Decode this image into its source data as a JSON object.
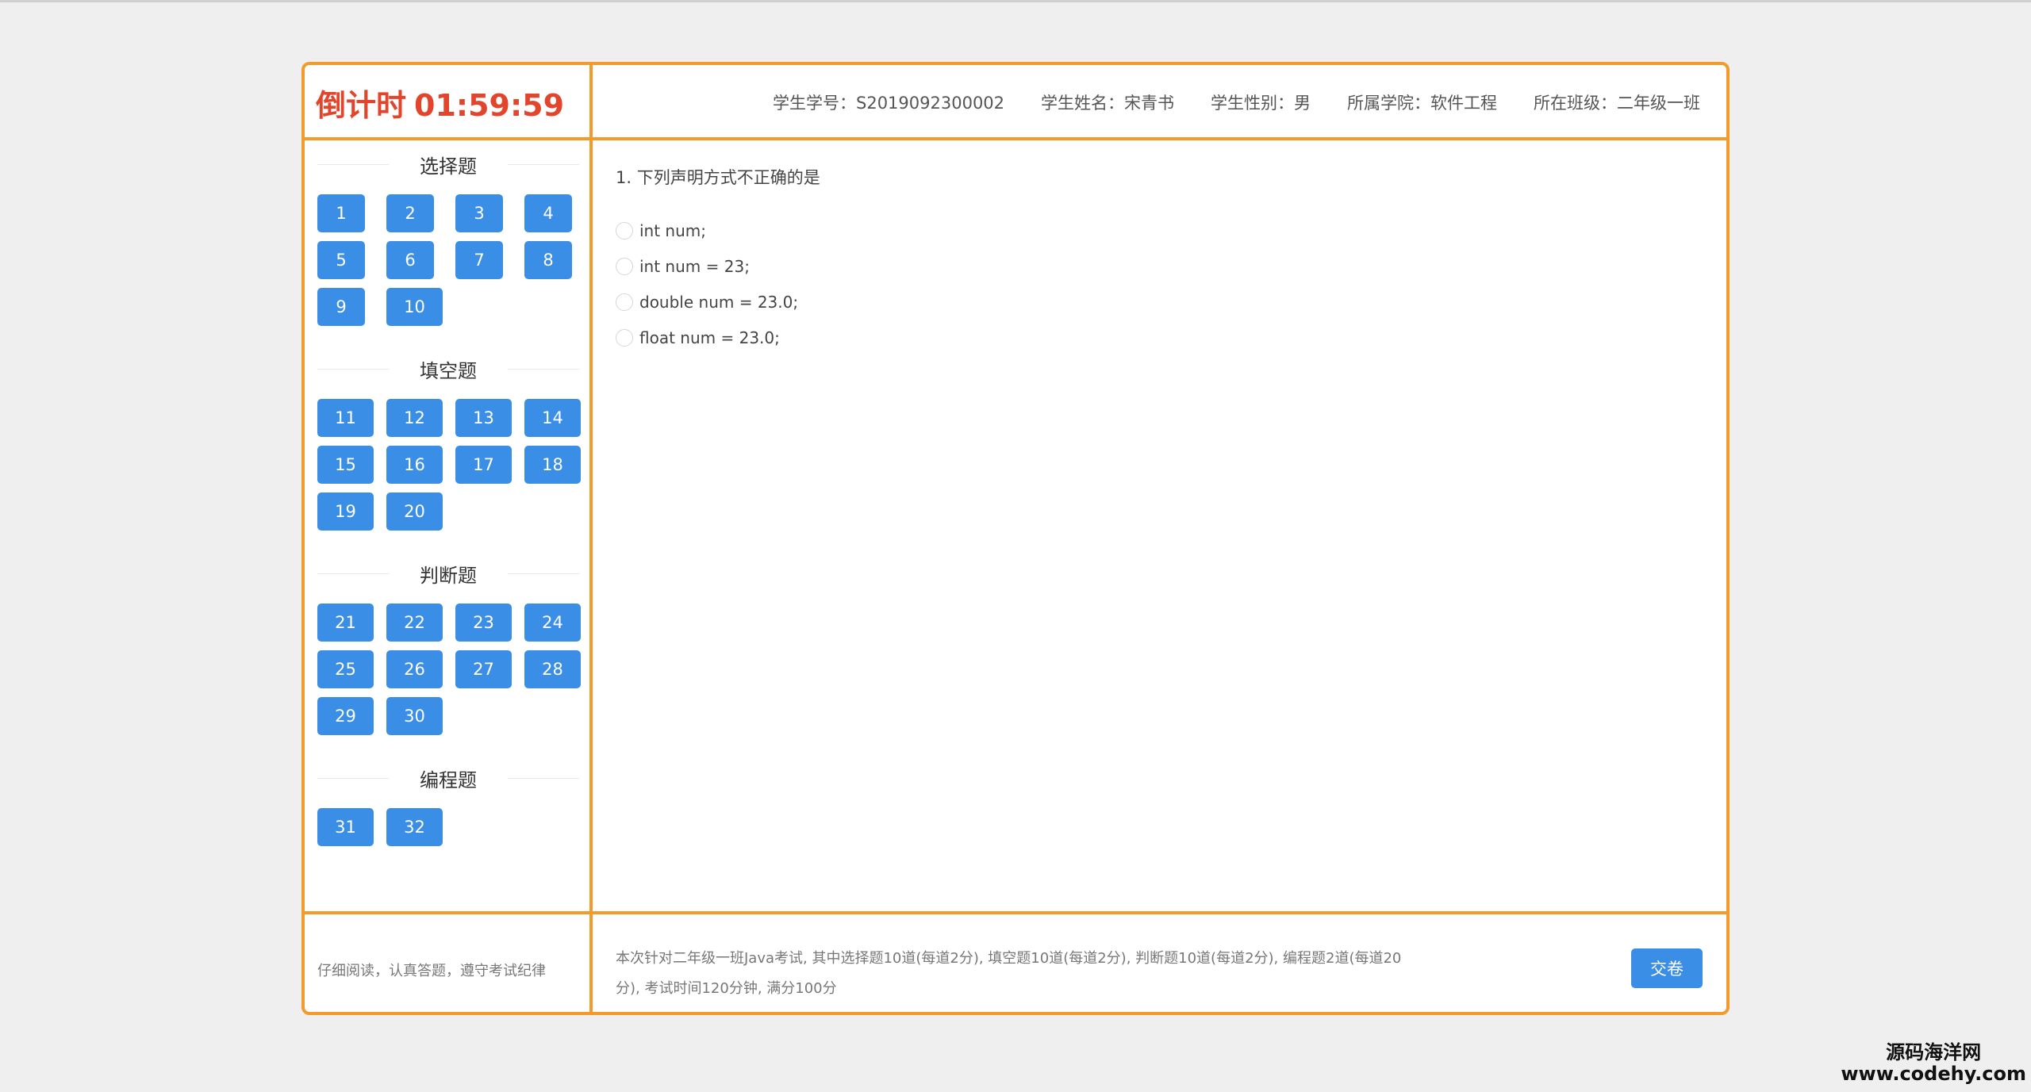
{
  "header": {
    "countdown_label": "倒计时",
    "countdown_time": "01:59:59",
    "student_id": "学生学号：S2019092300002",
    "student_name": "学生姓名：宋青书",
    "student_gender": "学生性别：男",
    "college": "所属学院：软件工程",
    "class": "所在班级：二年级一班"
  },
  "sections": [
    {
      "title": "选择题",
      "questions": [
        "1",
        "2",
        "3",
        "4",
        "5",
        "6",
        "7",
        "8",
        "9",
        "10"
      ]
    },
    {
      "title": "填空题",
      "questions": [
        "11",
        "12",
        "13",
        "14",
        "15",
        "16",
        "17",
        "18",
        "19",
        "20"
      ]
    },
    {
      "title": "判断题",
      "questions": [
        "21",
        "22",
        "23",
        "24",
        "25",
        "26",
        "27",
        "28",
        "29",
        "30"
      ]
    },
    {
      "title": "编程题",
      "questions": [
        "31",
        "32"
      ]
    }
  ],
  "question": {
    "text": "1. 下列声明方式不正确的是",
    "options": [
      "int num;",
      "int num = 23;",
      "double num = 23.0;",
      "float num = 23.0;"
    ]
  },
  "footer": {
    "note": "仔细阅读，认真答题，遵守考试纪律",
    "description": "本次针对二年级一班Java考试, 其中选择题10道(每道2分), 填空题10道(每道2分), 判断题10道(每道2分), 编程题2道(每道20分), 考试时间120分钟, 满分100分",
    "submit_label": "交卷"
  },
  "watermark": {
    "line1": "源码海洋网",
    "line2": "www.codehy.com"
  },
  "colors": {
    "accent_border": "#f29b2c",
    "countdown": "#e2452b",
    "button": "#3a8ee6"
  }
}
